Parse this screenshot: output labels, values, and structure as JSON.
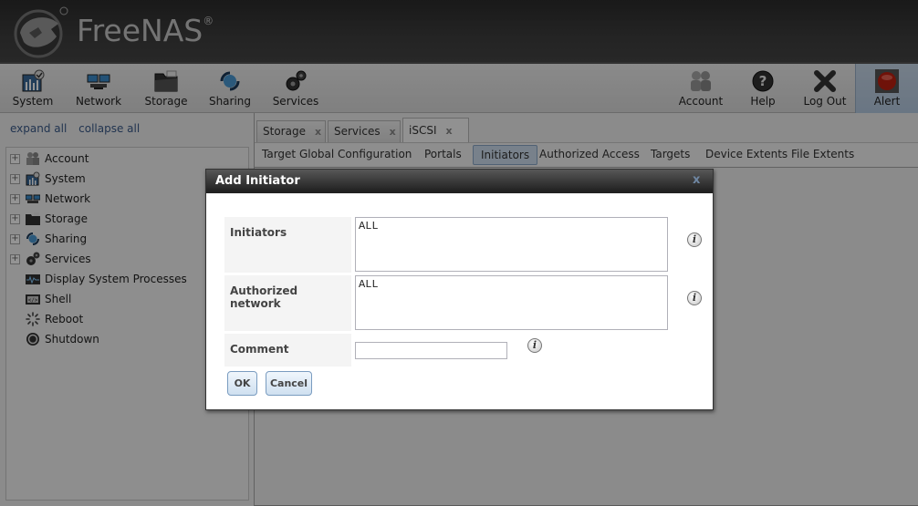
{
  "app": {
    "brand": "FreeNAS",
    "brand_mark": "®"
  },
  "toolbar": {
    "left_items": [
      {
        "label": "System",
        "icon": "system-icon"
      },
      {
        "label": "Network",
        "icon": "network-icon"
      },
      {
        "label": "Storage",
        "icon": "storage-icon"
      },
      {
        "label": "Sharing",
        "icon": "sharing-icon"
      },
      {
        "label": "Services",
        "icon": "services-icon"
      }
    ],
    "right_items": [
      {
        "label": "Account",
        "icon": "account-icon"
      },
      {
        "label": "Help",
        "icon": "help-icon"
      },
      {
        "label": "Log Out",
        "icon": "logout-icon"
      },
      {
        "label": "Alert",
        "icon": "alert-icon"
      }
    ]
  },
  "sidebar": {
    "expand_all": "expand all",
    "collapse_all": "collapse all",
    "items": [
      {
        "label": "Account",
        "expandable": true
      },
      {
        "label": "System",
        "expandable": true
      },
      {
        "label": "Network",
        "expandable": true
      },
      {
        "label": "Storage",
        "expandable": true
      },
      {
        "label": "Sharing",
        "expandable": true
      },
      {
        "label": "Services",
        "expandable": true
      },
      {
        "label": "Display System Processes",
        "expandable": false
      },
      {
        "label": "Shell",
        "expandable": false
      },
      {
        "label": "Reboot",
        "expandable": false
      },
      {
        "label": "Shutdown",
        "expandable": false
      }
    ]
  },
  "main": {
    "tabs": [
      {
        "label": "Storage",
        "close": "x"
      },
      {
        "label": "Services",
        "close": "x"
      },
      {
        "label": "iSCSI",
        "close": "x",
        "active": true
      }
    ],
    "subnav": [
      {
        "label": "Target Global Configuration"
      },
      {
        "label": "Portals"
      },
      {
        "label": "Initiators",
        "active": true
      },
      {
        "label": "Authorized Access"
      },
      {
        "label": "Targets"
      },
      {
        "label": "Device Extents"
      },
      {
        "label": "File Extents"
      }
    ]
  },
  "dialog": {
    "title": "Add Initiator",
    "close": "x",
    "fields": {
      "initiators": {
        "label": "Initiators",
        "value": "ALL"
      },
      "authorized_network": {
        "label": "Authorized network",
        "value": "ALL"
      },
      "comment": {
        "label": "Comment",
        "value": ""
      }
    },
    "info_glyph": "i",
    "ok_label": "OK",
    "cancel_label": "Cancel"
  }
}
